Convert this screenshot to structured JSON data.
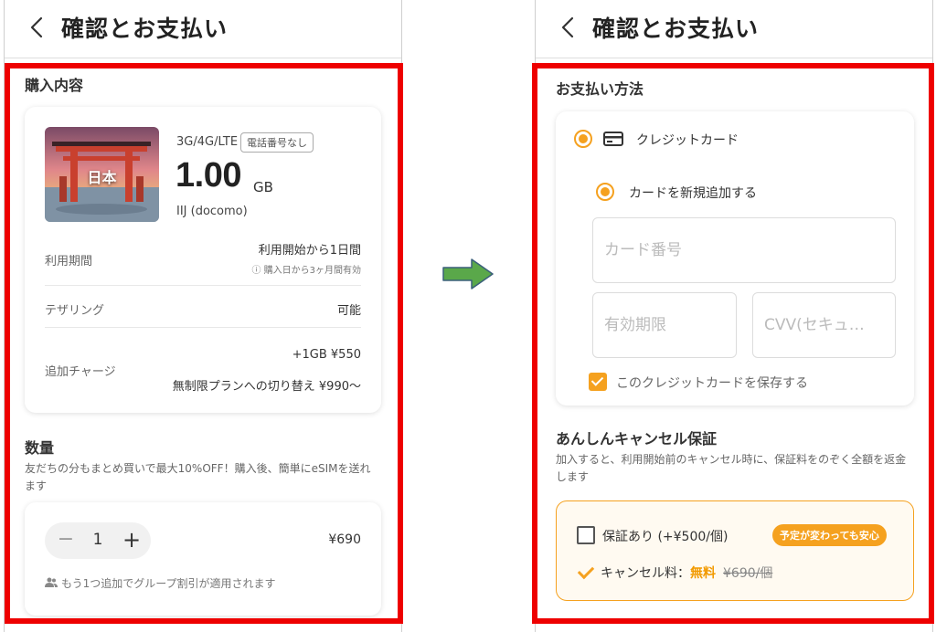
{
  "left": {
    "header": {
      "title": "確認とお支払い"
    },
    "purchase_section": {
      "title": "購入内容"
    },
    "product": {
      "image_label": "日本",
      "network": "3G/4G/LTE",
      "badge": "電話番号なし",
      "amount": "1.00",
      "unit": "GB",
      "carrier": "IIJ (docomo)"
    },
    "details": {
      "period_label": "利用期間",
      "period_value": "利用開始から1日間",
      "period_note": "ⓘ 購入日から3ヶ月間有効",
      "tethering_label": "テザリング",
      "tethering_value": "可能",
      "charge_label": "追加チャージ",
      "charge_value_1": "+1GB ¥550",
      "charge_value_2": "無制限プランへの切り替え ¥990〜"
    },
    "quantity_section": {
      "title": "数量",
      "description": "友だちの分もまとめ買いで最大10%OFF！購入後、簡単にeSIMを送れます",
      "minus": "−",
      "value": "1",
      "plus": "+",
      "price": "¥690",
      "group_note": "もう1つ追加でグループ割引が適用されます"
    }
  },
  "right": {
    "header": {
      "title": "確認とお支払い"
    },
    "payment_section": {
      "title": "お支払い方法"
    },
    "payment": {
      "credit_card_label": "クレジットカード",
      "new_card_label": "カードを新規追加する",
      "card_number_placeholder": "カード番号",
      "expiry_placeholder": "有効期限",
      "cvv_placeholder": "CVV(セキュ…",
      "save_card_label": "このクレジットカードを保存する"
    },
    "guarantee_section": {
      "title": "あんしんキャンセル保証",
      "description": "加入すると、利用開始前のキャンセル時に、保証料をのぞく全額を返金します",
      "option_label": "保証あり (+¥500/個)",
      "badge": "予定が変わっても安心",
      "fee_label": "キャンセル料：",
      "fee_free": "無料",
      "fee_old": "¥690/個"
    }
  },
  "colors": {
    "accent": "#f5a11f",
    "highlight_frame": "#ee0000",
    "arrow": "#5aa84a"
  }
}
